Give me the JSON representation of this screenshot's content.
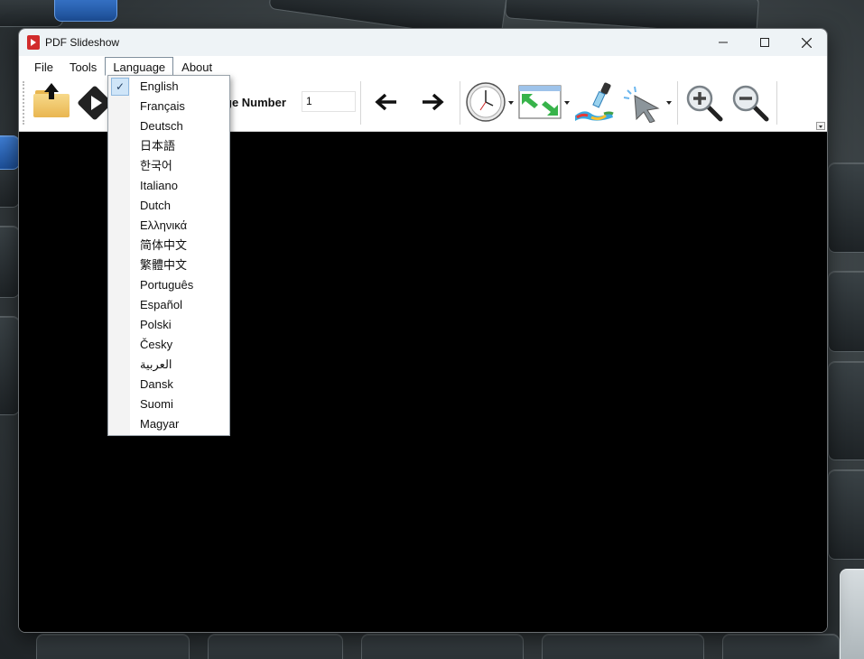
{
  "window": {
    "title": "PDF Slideshow"
  },
  "menubar": {
    "items": [
      "File",
      "Tools",
      "Language",
      "About"
    ]
  },
  "toolbar": {
    "page_label": "ge Number",
    "page_value": "1"
  },
  "language_menu": {
    "selected": "English",
    "items": [
      "English",
      "Français",
      "Deutsch",
      "日本語",
      "한국어",
      "Italiano",
      "Dutch",
      "Ελληνικά",
      "简体中文",
      "繁體中文",
      "Português",
      "Español",
      "Polski",
      "Česky",
      "العربية",
      "Dansk",
      "Suomi",
      "Magyar"
    ]
  },
  "icons": {
    "app": "pdf-slideshow-icon",
    "open": "open-folder-icon",
    "play": "play-icon",
    "prev": "arrow-left-icon",
    "next": "arrow-right-icon",
    "timer": "clock-icon",
    "transition": "transition-icon",
    "color": "paint-icon",
    "pointer": "pointer-icon",
    "zoom_in": "zoom-in-icon",
    "zoom_out": "zoom-out-icon"
  },
  "colors": {
    "viewer_bg": "#000000",
    "check_highlight": "#cfe5f8",
    "titlebar_bg": "#eef3f6"
  }
}
